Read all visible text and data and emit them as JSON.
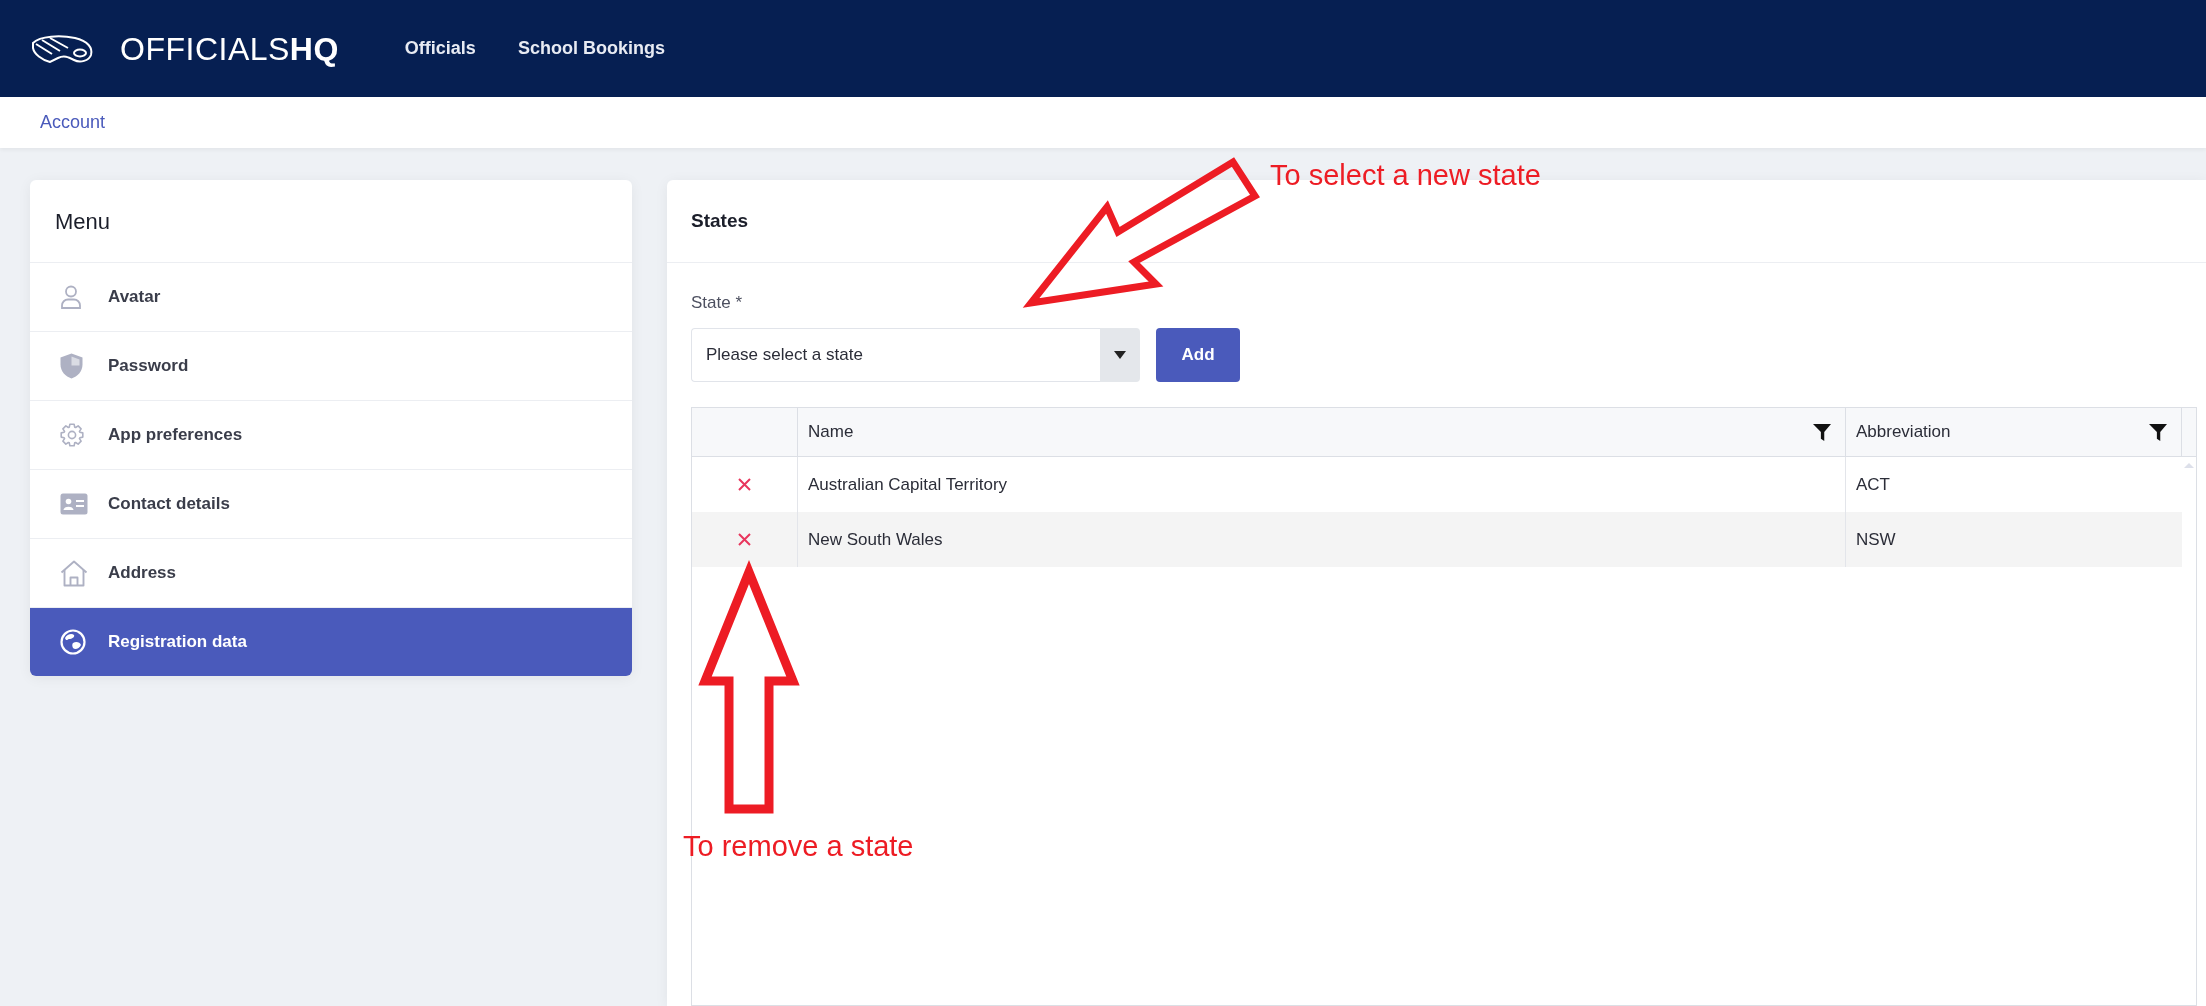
{
  "header": {
    "logo_text": "OFFICIALS**HQ**",
    "nav": [
      {
        "label": "Officials"
      },
      {
        "label": "School Bookings"
      }
    ]
  },
  "breadcrumb": {
    "label": "Account"
  },
  "menu": {
    "title": "Menu",
    "items": [
      {
        "label": "Avatar",
        "selected": false
      },
      {
        "label": "Password",
        "selected": false
      },
      {
        "label": "App preferences",
        "selected": false
      },
      {
        "label": "Contact details",
        "selected": false
      },
      {
        "label": "Address",
        "selected": false
      },
      {
        "label": "Registration data",
        "selected": true
      }
    ]
  },
  "states_panel": {
    "title": "States",
    "state_field": {
      "label": "State *",
      "placeholder": "Please select a state"
    },
    "add_button": {
      "label": "Add"
    },
    "table": {
      "columns": [
        {
          "label": "Name"
        },
        {
          "label": "Abbreviation"
        }
      ],
      "rows": [
        {
          "name": "Australian Capital Territory",
          "abbreviation": "ACT"
        },
        {
          "name": "New South Wales",
          "abbreviation": "NSW"
        }
      ]
    }
  },
  "annotations": [
    {
      "kind": "arrow-down-left",
      "text": "To select a new state"
    },
    {
      "kind": "arrow-up",
      "text": "To remove a state"
    }
  ]
}
